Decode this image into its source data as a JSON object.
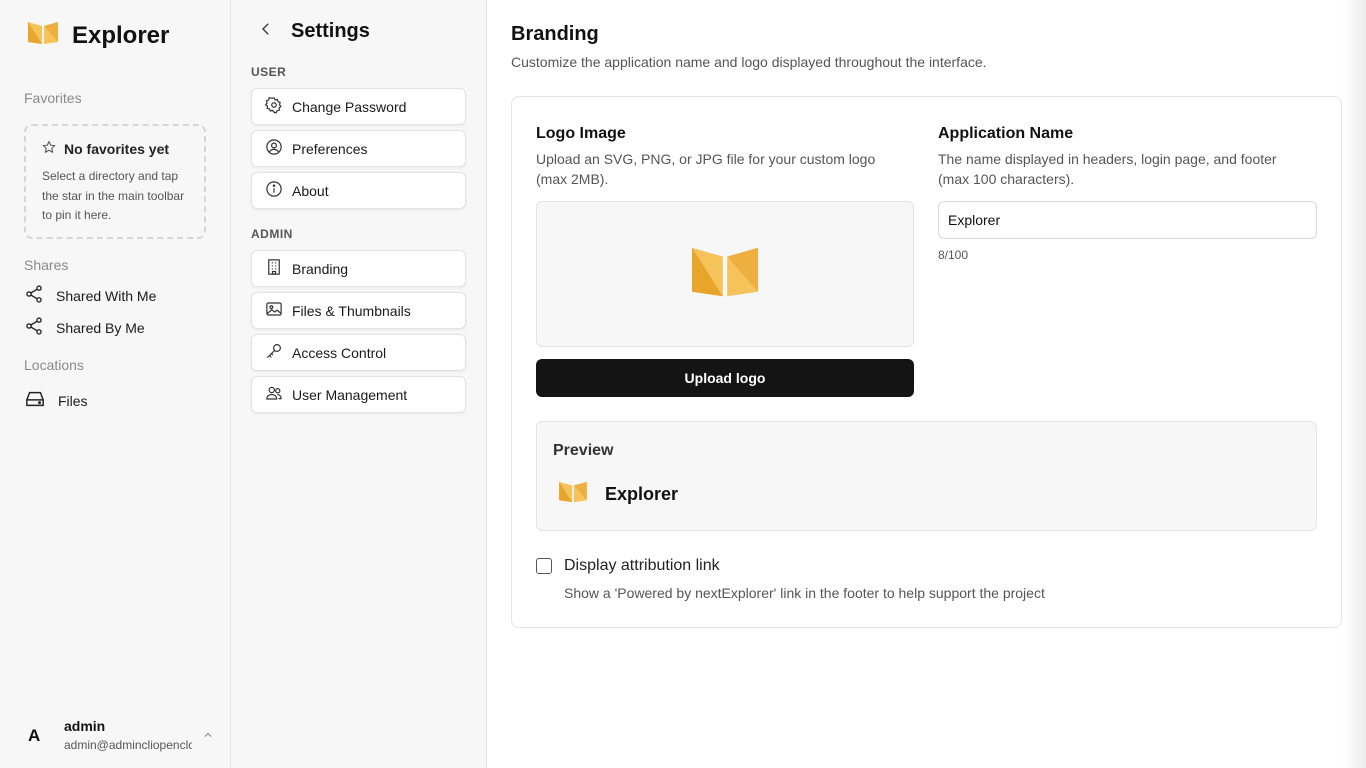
{
  "app": {
    "title": "Explorer"
  },
  "sidebar": {
    "favorites": {
      "label": "Favorites",
      "empty_title": "No favorites yet",
      "empty_text": "Select a directory and tap the star in the main toolbar to pin it here."
    },
    "shares": {
      "label": "Shares",
      "items": [
        {
          "label": "Shared With Me",
          "icon": "share-icon"
        },
        {
          "label": "Shared By Me",
          "icon": "share-icon"
        }
      ]
    },
    "locations": {
      "label": "Locations",
      "items": [
        {
          "label": "Files",
          "icon": "drive-icon"
        }
      ]
    },
    "user": {
      "initial": "A",
      "name": "admin",
      "email": "admin@admincliopencloud"
    }
  },
  "settings": {
    "title": "Settings",
    "groups": [
      {
        "label": "USER",
        "items": [
          {
            "label": "Change Password",
            "icon": "gear-icon"
          },
          {
            "label": "Preferences",
            "icon": "user-circle-icon"
          },
          {
            "label": "About",
            "icon": "info-icon"
          }
        ]
      },
      {
        "label": "ADMIN",
        "items": [
          {
            "label": "Branding",
            "icon": "building-icon"
          },
          {
            "label": "Files & Thumbnails",
            "icon": "image-icon"
          },
          {
            "label": "Access Control",
            "icon": "key-icon"
          },
          {
            "label": "User Management",
            "icon": "users-icon"
          }
        ]
      }
    ]
  },
  "branding": {
    "title": "Branding",
    "subtitle": "Customize the application name and logo displayed throughout the interface.",
    "logo": {
      "title": "Logo Image",
      "desc_line1": "Upload an SVG, PNG, or JPG file for your custom logo",
      "desc_line2": "(max 2MB).",
      "upload_label": "Upload logo"
    },
    "app_name": {
      "title": "Application Name",
      "desc_line1": "The name displayed in headers, login page, and footer",
      "desc_line2": "(max 100 characters).",
      "value": "Explorer",
      "count": "8/100"
    },
    "preview": {
      "label": "Preview",
      "name": "Explorer"
    },
    "attribution": {
      "label": "Display attribution link",
      "desc": "Show a 'Powered by nextExplorer' link in the footer to help support the project",
      "checked": false
    }
  },
  "colors": {
    "accent": "#F2B441",
    "accent_dark": "#E09A1F",
    "button_bg": "#141414"
  }
}
